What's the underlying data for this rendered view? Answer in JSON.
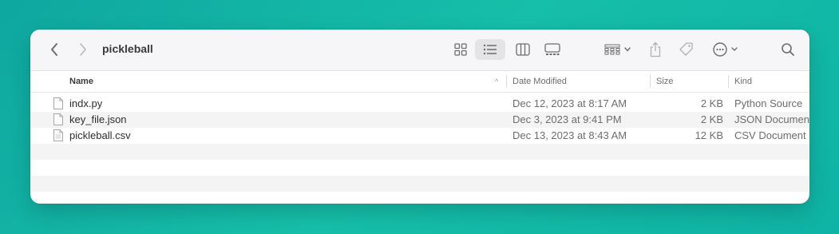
{
  "toolbar": {
    "title": "pickleball"
  },
  "columns": {
    "name": "Name",
    "date_modified": "Date Modified",
    "size": "Size",
    "kind": "Kind",
    "sort_indicator": "^"
  },
  "files": [
    {
      "name": "indx.py",
      "date": "Dec 12, 2023 at 8:17 AM",
      "size": "2 KB",
      "kind": "Python Source"
    },
    {
      "name": "key_file.json",
      "date": "Dec 3, 2023 at 9:41 PM",
      "size": "2 KB",
      "kind": "JSON Document"
    },
    {
      "name": "pickleball.csv",
      "date": "Dec 13, 2023 at 8:43 AM",
      "size": "12 KB",
      "kind": "CSV Document"
    }
  ],
  "icons": {
    "back": "chevron-left-icon",
    "forward": "chevron-right-icon",
    "icon_view": "grid-icon",
    "list_view": "list-icon",
    "column_view": "columns-icon",
    "gallery_view": "gallery-icon",
    "group": "group-icon",
    "share": "share-icon",
    "tag": "tag-icon",
    "more": "ellipsis-circle-icon",
    "search": "search-icon",
    "file": "document-icon"
  },
  "colors": {
    "background": "#12b3a5",
    "window": "#ffffff",
    "toolbar": "#f6f6f8",
    "row_alt": "#f4f4f5",
    "selected_view": "#e4e4e6"
  }
}
